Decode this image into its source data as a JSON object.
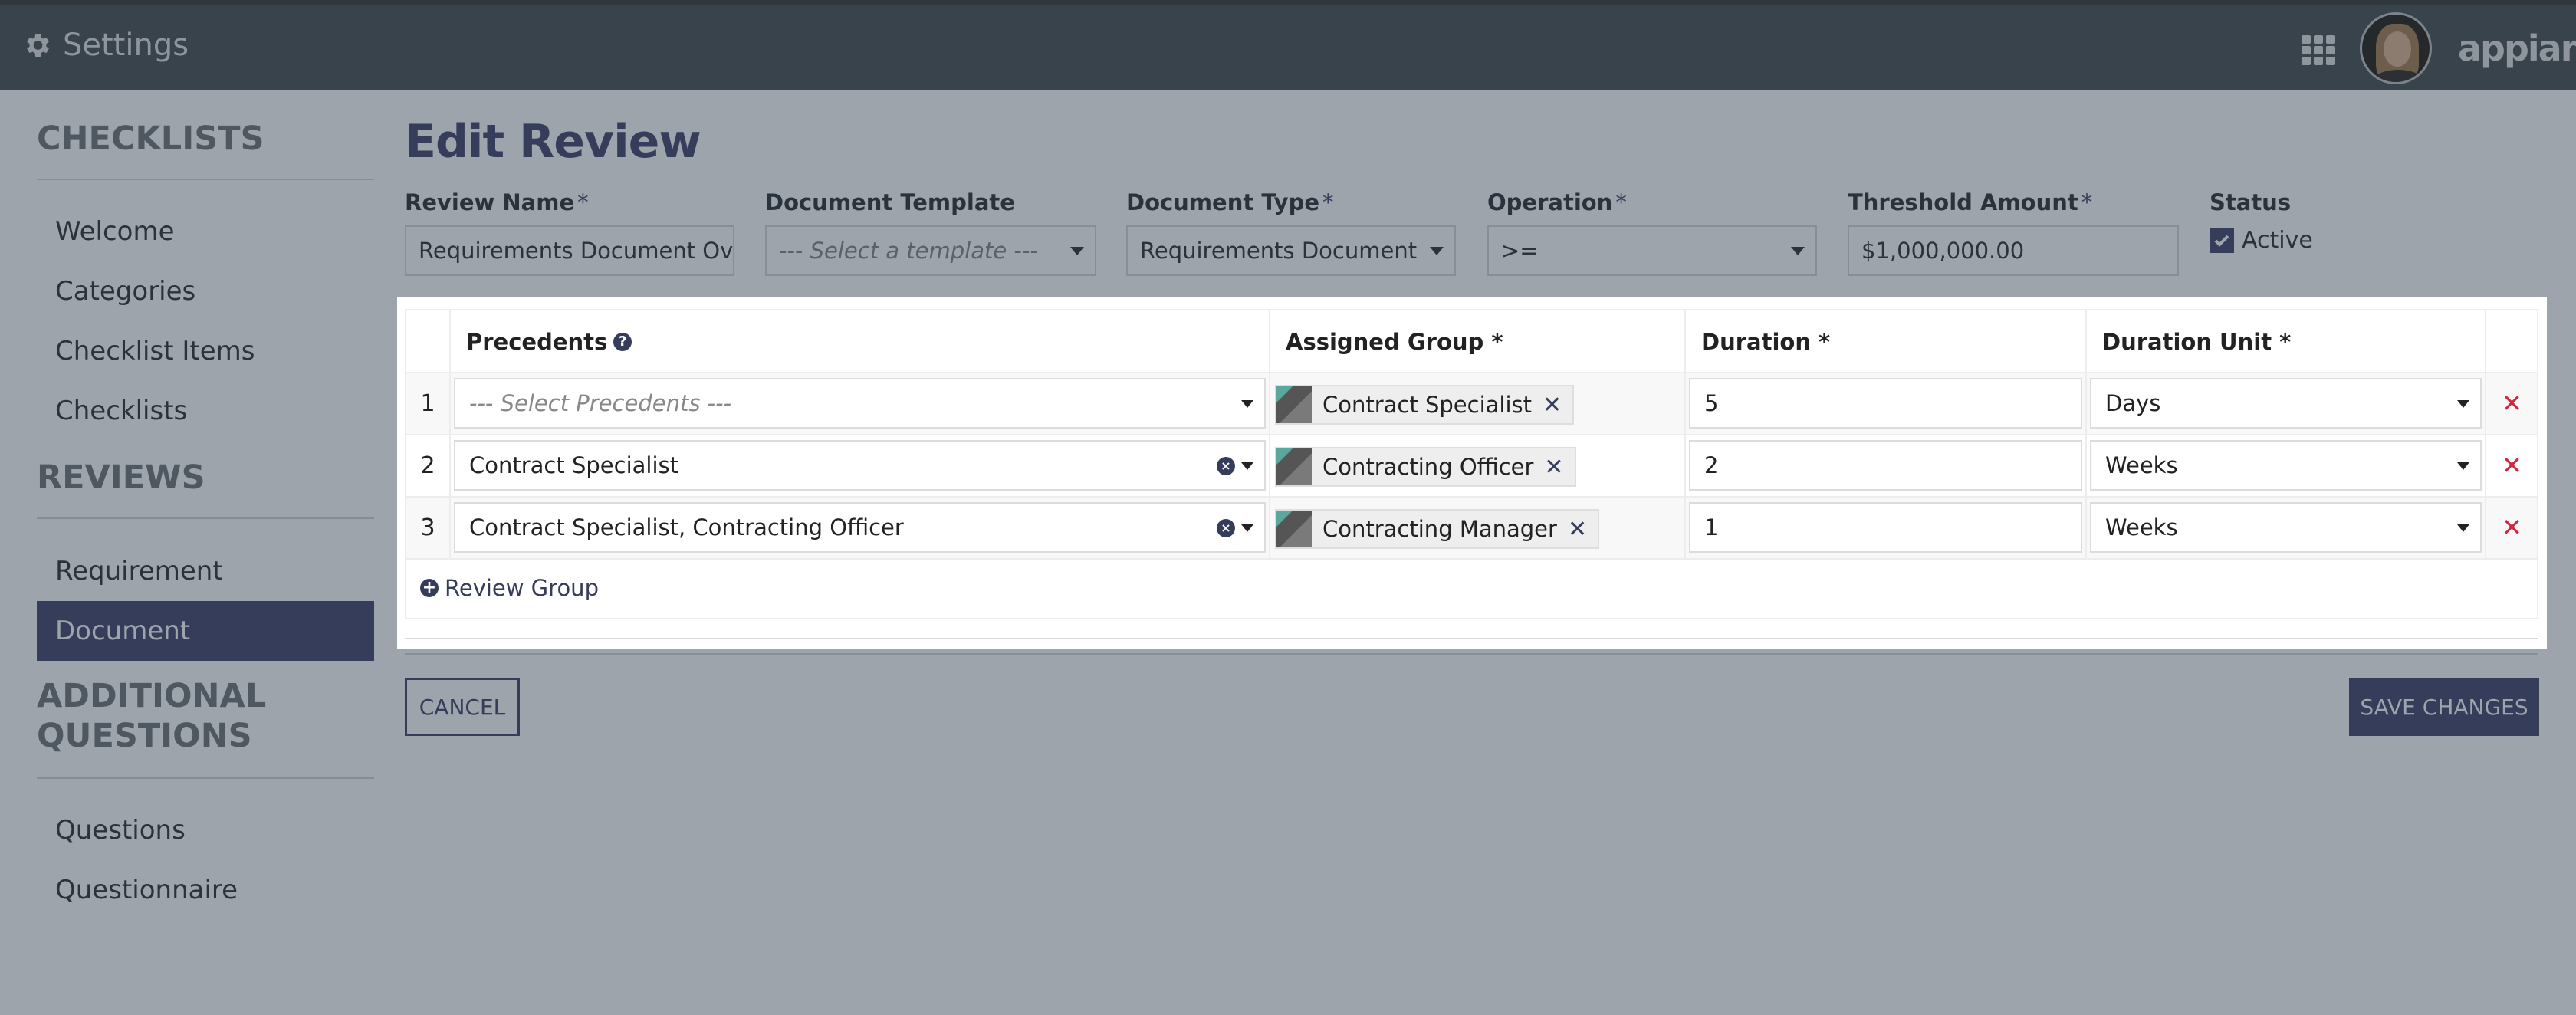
{
  "header": {
    "title": "Settings",
    "logo_text": "appian"
  },
  "sidebar": {
    "sections": [
      {
        "heading": "CHECKLISTS",
        "items": [
          "Welcome",
          "Categories",
          "Checklist Items",
          "Checklists"
        ]
      },
      {
        "heading": "REVIEWS",
        "items": [
          "Requirement",
          "Document"
        ]
      },
      {
        "heading_line1": "ADDITIONAL",
        "heading_line2": "QUESTIONS",
        "items": [
          "Questions",
          "Questionnaire"
        ]
      }
    ],
    "active_item": "Document"
  },
  "page": {
    "title": "Edit Review"
  },
  "form": {
    "review_name": {
      "label": "Review Name",
      "required": "*",
      "value": "Requirements Document Over"
    },
    "document_template": {
      "label": "Document Template",
      "placeholder": "--- Select a template ---"
    },
    "document_type": {
      "label": "Document Type",
      "required": "*",
      "value": "Requirements Document"
    },
    "operation": {
      "label": "Operation",
      "required": "*",
      "value": ">="
    },
    "threshold_amount": {
      "label": "Threshold Amount",
      "required": "*",
      "value": "$1,000,000.00"
    },
    "status": {
      "label": "Status",
      "checkbox_label": "Active",
      "checked": true
    }
  },
  "table": {
    "headers": {
      "precedents": "Precedents",
      "assigned_group": "Assigned Group *",
      "duration": "Duration *",
      "duration_unit": "Duration Unit *"
    },
    "rows": [
      {
        "num": "1",
        "precedents": "--- Select Precedents ---",
        "precedents_is_placeholder": true,
        "group": "Contract Specialist",
        "duration": "5",
        "unit": "Days"
      },
      {
        "num": "2",
        "precedents": "Contract Specialist",
        "precedents_is_placeholder": false,
        "group": "Contracting Officer",
        "duration": "2",
        "unit": "Weeks"
      },
      {
        "num": "3",
        "precedents": "Contract Specialist, Contracting Officer",
        "precedents_is_placeholder": false,
        "group": "Contracting Manager",
        "duration": "1",
        "unit": "Weeks"
      }
    ],
    "add_link": "Review Group"
  },
  "buttons": {
    "cancel": "CANCEL",
    "save": "SAVE CHANGES"
  },
  "colors": {
    "accent": "#353d5b",
    "header_bg": "#39434b",
    "overlay_bg": "#9da4ac",
    "delete": "#d0273e"
  }
}
